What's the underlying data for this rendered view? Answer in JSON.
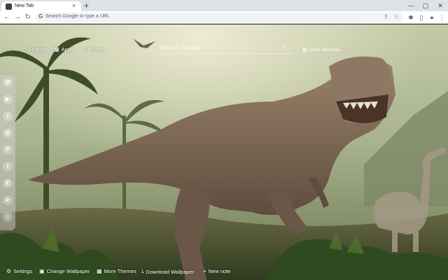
{
  "browser": {
    "tab_title": "New Tab",
    "tab_close": "×",
    "new_tab": "+",
    "omnibox_placeholder": "Search Google or type a URL",
    "window_controls": [
      "—",
      "▢",
      "✕"
    ]
  },
  "top_links": {
    "history": "History",
    "apps": "Apps",
    "share": "Share"
  },
  "search": {
    "placeholder": "Search Google"
  },
  "shortcuts": {
    "label": "Show Shortcuts"
  },
  "social": [
    {
      "name": "gmail-icon",
      "glyph": "M"
    },
    {
      "name": "youtube-icon",
      "glyph": "▶"
    },
    {
      "name": "facebook-icon",
      "glyph": "f"
    },
    {
      "name": "instagram-icon",
      "glyph": "◎"
    },
    {
      "name": "pinterest-icon",
      "glyph": "P"
    },
    {
      "name": "twitter-icon",
      "glyph": "t"
    },
    {
      "name": "whatsapp-icon",
      "glyph": "✆"
    },
    {
      "name": "telegram-icon",
      "glyph": "➤"
    },
    {
      "name": "reddit-icon",
      "glyph": "☺"
    }
  ],
  "bottom": {
    "settings": "Settings",
    "change_wallpaper": "Change Wallpaper",
    "more_themes": "More Themes",
    "download_wallpaper": "Download Wallpaper",
    "new_note": "New note"
  },
  "colors": {
    "sky": "#a8b59a",
    "jungle": "#3a4a2a",
    "dino_body": "#8a7460",
    "dino_dark": "#5c4b3c"
  }
}
